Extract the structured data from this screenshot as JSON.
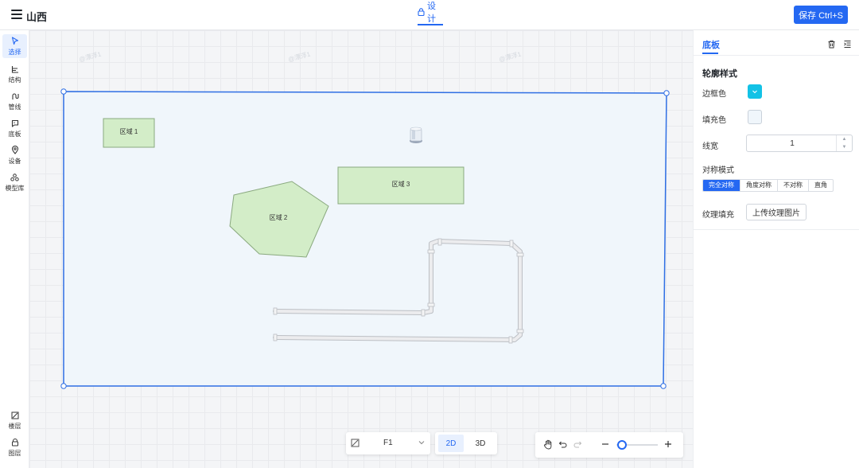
{
  "header": {
    "project_title": "山西",
    "design_tab": "设计",
    "save_label": "保存 Ctrl+S",
    "accent": "#2468f2"
  },
  "left_toolbar": {
    "items": [
      {
        "label": "选择",
        "icon": "cursor-icon"
      },
      {
        "label": "结构",
        "icon": "structure-icon"
      },
      {
        "label": "管线",
        "icon": "pipeline-icon"
      },
      {
        "label": "底板",
        "icon": "baseplate-icon"
      },
      {
        "label": "设备",
        "icon": "device-pin-icon"
      },
      {
        "label": "模型库",
        "icon": "model-library-icon"
      }
    ],
    "bottom_items": [
      {
        "label": "楼层",
        "icon": "floor-icon"
      },
      {
        "label": "图层",
        "icon": "layer-icon"
      }
    ]
  },
  "canvas": {
    "regions": [
      {
        "label": "区域 1"
      },
      {
        "label": "区域 2"
      },
      {
        "label": "区域 3"
      }
    ],
    "watermark": "@漂浮1",
    "floor_select": "F1",
    "view_2d": "2D",
    "view_3d": "3D"
  },
  "right_panel": {
    "tab": "底板",
    "section_title": "轮廓样式",
    "border_color_label": "边框色",
    "fill_color_label": "填充色",
    "line_width_label": "线宽",
    "line_width_value": "1",
    "symmetry_label": "对称模式",
    "symmetry_options": [
      "完全对称",
      "角度对称",
      "不对称",
      "直角"
    ],
    "symmetry_selected": "完全对称",
    "texture_label": "纹理填充",
    "upload_label": "上传纹理图片",
    "border_color": "#13c2e6",
    "fill_color": "#f0f6fb"
  }
}
